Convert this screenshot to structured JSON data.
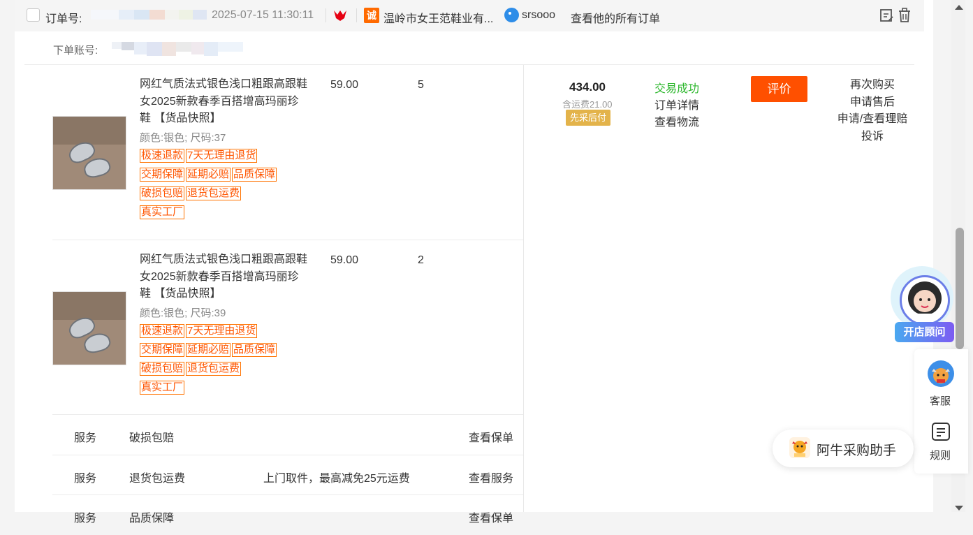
{
  "order": {
    "order_no_label": "订单号:",
    "datetime": "2025-07-15 11:30:11",
    "shop_name": "温岭市女王范鞋业有...",
    "wangwang": "srsooo",
    "view_all_orders": "查看他的所有订单",
    "account_label": "下单账号:",
    "accent_color": "#ff5000"
  },
  "items": [
    {
      "title": "网红气质法式银色浅口粗跟高跟鞋女2025新款春季百搭增高玛丽珍鞋",
      "snapshot": "【货品快照】",
      "spec": "颜色:银色; 尺码:37",
      "tags": [
        "极速退款",
        "7天无理由退货",
        "交期保障",
        "延期必赔",
        "品质保障",
        "破损包赔",
        "退货包运费",
        "真实工厂"
      ],
      "price": "59.00",
      "qty": "5"
    },
    {
      "title": "网红气质法式银色浅口粗跟高跟鞋女2025新款春季百搭增高玛丽珍鞋",
      "snapshot": "【货品快照】",
      "spec": "颜色:银色; 尺码:39",
      "tags": [
        "极速退款",
        "7天无理由退货",
        "交期保障",
        "延期必赔",
        "品质保障",
        "破损包赔",
        "退货包运费",
        "真实工厂"
      ],
      "price": "59.00",
      "qty": "2"
    }
  ],
  "summary": {
    "total": "434.00",
    "shipping": "含运费21.00",
    "badge": "先采后付",
    "status": "交易成功",
    "detail_link": "订单详情",
    "logistics_link": "查看物流",
    "rate_button": "评价",
    "actions": [
      "再次购买",
      "申请售后",
      "申请/查看理赔",
      "投诉"
    ]
  },
  "services": [
    {
      "label": "服务",
      "name": "破损包赔",
      "desc": "",
      "link": "查看保单"
    },
    {
      "label": "服务",
      "name": "退货包运费",
      "desc": "上门取件，最高减免25元运费",
      "link": "查看服务"
    },
    {
      "label": "服务",
      "name": "品质保障",
      "desc": "",
      "link": "查看保单"
    }
  ],
  "widgets": {
    "advisor": "开店顾问",
    "assistant": "阿牛采购助手",
    "service": "客服",
    "rules": "规则"
  }
}
